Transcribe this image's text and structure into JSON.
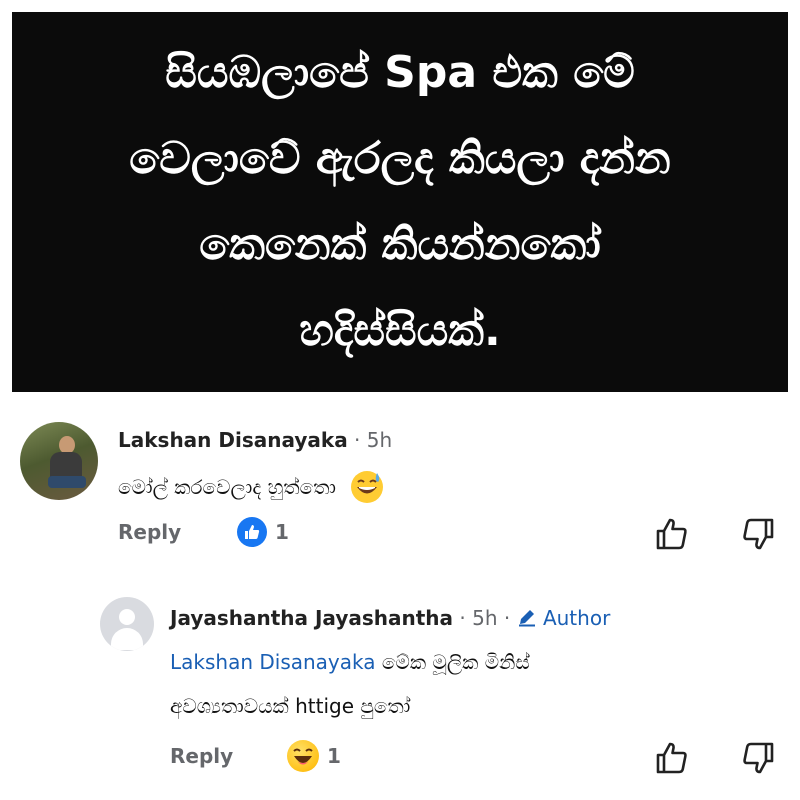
{
  "post": {
    "lines": [
      "සියඹලාපේ Spa එක මේ",
      "වෙලාවේ ඇරලද කියලා දන්න",
      "කෙනෙක් කියන්නකෝ",
      "හදිස්සියක්."
    ]
  },
  "comments": [
    {
      "author": "Lakshan Disanayaka",
      "separator": "·",
      "time": "5h",
      "text": "මෝල් කරවෙලාද හුත්තො",
      "reply_label": "Reply",
      "reaction_count": "1",
      "reaction_icon": "like-icon"
    },
    {
      "author": "Jayashantha Jayashantha",
      "separator": "·",
      "time": "5h",
      "separator2": "·",
      "badge": "Author",
      "mention": "Lakshan Disanayaka",
      "text_line1": "මේක මූලික මිනිස්",
      "text_line2": "අවශ්‍යතාවයක් httige පුතෝ",
      "reply_label": "Reply",
      "reaction_count": "1",
      "reaction_icon": "haha-emoji"
    }
  ],
  "colors": {
    "banner_bg": "#0b0b0b",
    "link": "#1a5fb4",
    "like": "#1877f2",
    "meta": "#65676b"
  }
}
